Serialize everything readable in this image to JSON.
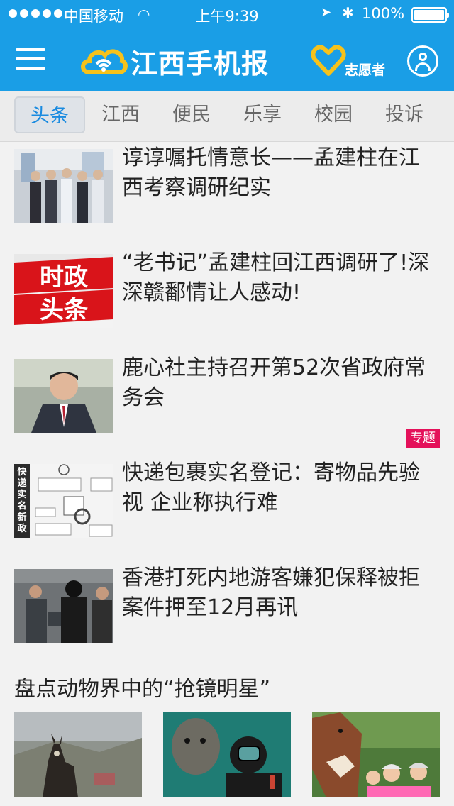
{
  "status_bar": {
    "carrier": "中国移动",
    "time": "上午9:39",
    "battery": "100%"
  },
  "header": {
    "brand": "江西手机报",
    "volunteer_label": "志愿者",
    "icons": [
      "menu-icon",
      "logo-icon",
      "volunteer-heart-icon",
      "user-icon"
    ]
  },
  "tabs": [
    {
      "label": "头条",
      "active": true
    },
    {
      "label": "江西",
      "active": false
    },
    {
      "label": "便民",
      "active": false
    },
    {
      "label": "乐享",
      "active": false
    },
    {
      "label": "校园",
      "active": false
    },
    {
      "label": "投诉",
      "active": false
    }
  ],
  "news": [
    {
      "title": "谆谆嘱托情意长——孟建柱在江西考察调研纪实"
    },
    {
      "title": "“老书记”孟建柱回江西调研了!深深赣鄱情让人感动!",
      "thumb_text": [
        "时政",
        "头条"
      ]
    },
    {
      "title": "鹿心社主持召开第52次省政府常务会",
      "tag": "专题"
    },
    {
      "title": "快递包裹实名登记：寄物品先验视 企业称执行难",
      "thumb_text": "快递实名新政"
    },
    {
      "title": "香港打死内地游客嫌犯保释被拒 案件押至12月再讯"
    }
  ],
  "gallery": {
    "title": "盘点动物界中的“抢镜明星”"
  },
  "colors": {
    "header_bg": "#1a9ee6",
    "accent": "#1a8be0",
    "tag_bg": "#e4115a",
    "logo_yellow": "#f6c21b"
  }
}
